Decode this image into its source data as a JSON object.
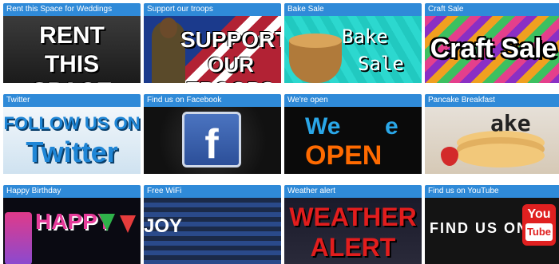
{
  "cards": [
    {
      "title": "Rent this Space for Weddings",
      "thumb_text": [
        "RENT",
        "THIS SPACE"
      ]
    },
    {
      "title": "Support our troops",
      "thumb_text": [
        "SUPPORT",
        "OUR TROOPS"
      ]
    },
    {
      "title": "Bake Sale",
      "thumb_text": [
        "Bake",
        "Sale"
      ]
    },
    {
      "title": "Craft Sale",
      "thumb_text": [
        "Craft Sale"
      ]
    },
    {
      "title": "Twitter",
      "thumb_text": [
        "FOLLOW US ON",
        "Twitter"
      ]
    },
    {
      "title": "Find us on Facebook",
      "thumb_text": [
        "f"
      ]
    },
    {
      "title": "We're open",
      "thumb_text": [
        "We",
        "e",
        "OPEN"
      ]
    },
    {
      "title": "Pancake Breakfast",
      "thumb_text": [
        "ake"
      ]
    },
    {
      "title": "Happy Birthday",
      "thumb_text": [
        "HAPPY"
      ]
    },
    {
      "title": "Free WiFi",
      "thumb_text": [
        "JOY"
      ]
    },
    {
      "title": "Weather alert",
      "thumb_text": [
        "WEATHER",
        "ALERT"
      ]
    },
    {
      "title": "Find us on YouTube",
      "thumb_text": [
        "FIND US ON",
        "You",
        "Tube"
      ]
    }
  ],
  "colors": {
    "title_bar": "#2f8ad8",
    "title_text": "#ffffff",
    "open_orange": "#ff6a00",
    "open_blue": "#2aa7e8",
    "weather_red": "#e21d1d"
  }
}
